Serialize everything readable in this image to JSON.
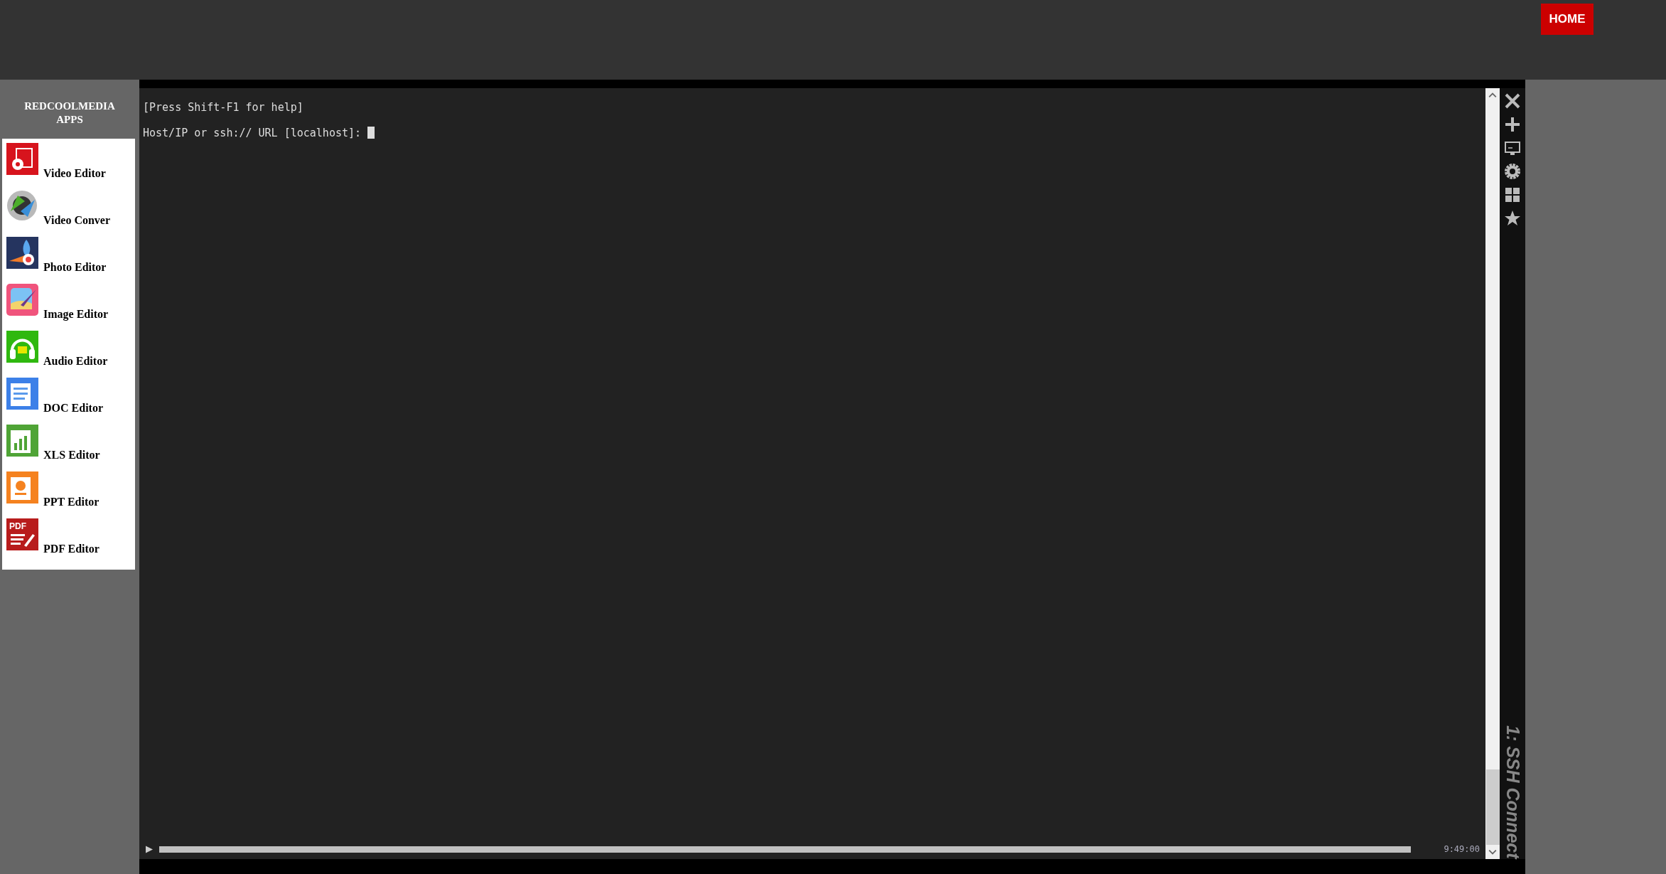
{
  "header": {
    "home_button": "HOME"
  },
  "sidebar": {
    "title": "REDCOOLMEDIA APPS",
    "items": [
      {
        "label": "Video Editor",
        "kind": "video"
      },
      {
        "label": "Video Conver",
        "kind": "convert"
      },
      {
        "label": "Photo Editor",
        "kind": "photo"
      },
      {
        "label": "Image Editor",
        "kind": "image"
      },
      {
        "label": "Audio Editor",
        "kind": "audio"
      },
      {
        "label": "DOC Editor",
        "kind": "doc"
      },
      {
        "label": "XLS Editor",
        "kind": "xls"
      },
      {
        "label": "PPT Editor",
        "kind": "ppt"
      },
      {
        "label": "PDF Editor",
        "kind": "pdf",
        "badge": "PDF"
      }
    ]
  },
  "terminal": {
    "lines": [
      "[Press Shift-F1 for help]",
      "Host/IP or ssh:// URL [localhost]:"
    ],
    "clock": "9:49:00",
    "session_tab": "1: SSH Connect"
  }
}
